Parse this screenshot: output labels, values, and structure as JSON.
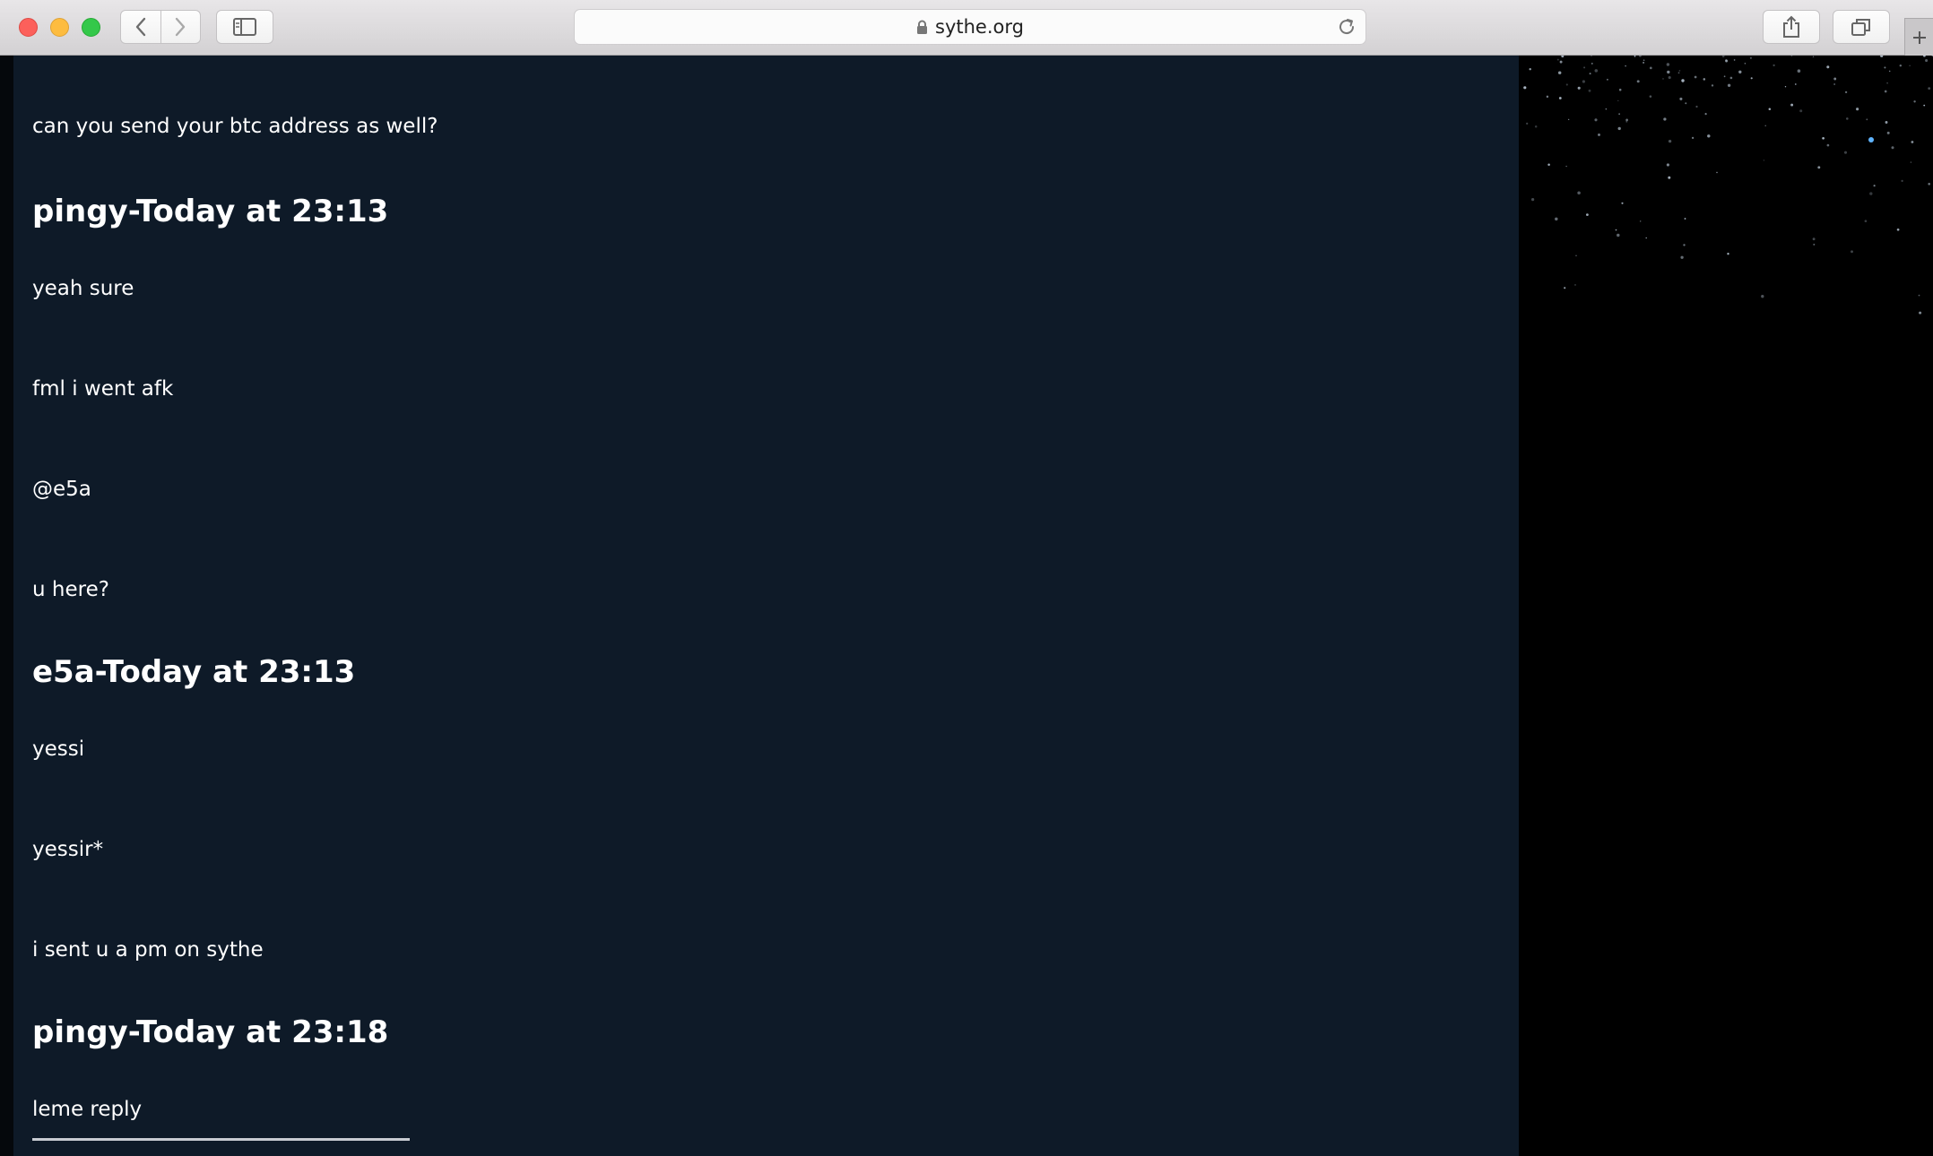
{
  "browser": {
    "url": "sythe.org",
    "icons": {
      "back": "chevron-left-icon",
      "forward": "chevron-right-icon",
      "sidebar": "sidebar-icon",
      "lock": "lock-icon",
      "reload": "reload-icon",
      "share": "share-icon",
      "tabs": "tabs-icon",
      "new_tab": "plus-icon"
    }
  },
  "chat": {
    "items": [
      {
        "kind": "message",
        "text": "can you send your btc address as well?"
      },
      {
        "kind": "header",
        "text": "pingy-Today at 23:13"
      },
      {
        "kind": "message",
        "text": "yeah sure"
      },
      {
        "kind": "message",
        "text": "fml i went afk"
      },
      {
        "kind": "message",
        "text": "@e5a"
      },
      {
        "kind": "message",
        "text": "u here?"
      },
      {
        "kind": "header",
        "text": "e5a-Today at 23:13"
      },
      {
        "kind": "message",
        "text": "yessi"
      },
      {
        "kind": "message",
        "text": "yessir*"
      },
      {
        "kind": "message",
        "text": "i sent u a pm on sythe"
      },
      {
        "kind": "header",
        "text": "pingy-Today at 23:18"
      },
      {
        "kind": "message",
        "text": "leme reply"
      }
    ]
  },
  "colors": {
    "chat_background": "#0e1a28",
    "page_background": "#000000",
    "text": "#ffffff"
  }
}
